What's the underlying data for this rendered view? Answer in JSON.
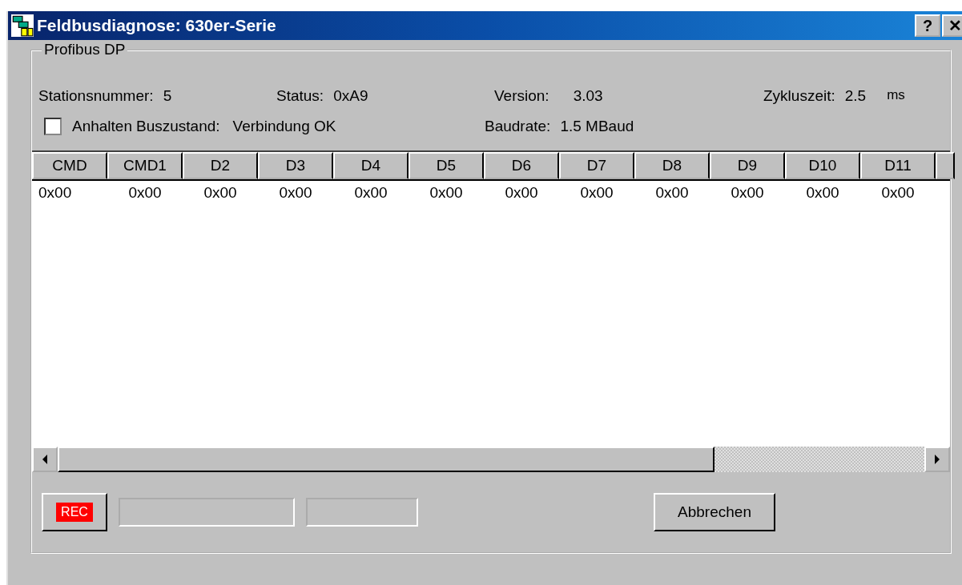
{
  "window": {
    "title": "Feldbusdiagnose: 630er-Serie",
    "help_button": "?",
    "close_button": "✕"
  },
  "group": {
    "title": "Profibus DP",
    "info_row_1": [
      {
        "label": "Stationsnummer:",
        "value": "5"
      },
      {
        "label": "Status:",
        "value": "0xA9"
      },
      {
        "label": "Version:",
        "value": "3.03"
      },
      {
        "label": "Zykluszeit:",
        "value": "2.5",
        "unit": "ms"
      }
    ],
    "pause_checkbox": {
      "label": "Anhalten",
      "checked": false
    },
    "info_row_2": [
      {
        "label": "Buszustand:",
        "value": "Verbindung OK"
      },
      {
        "label": "Baudrate:",
        "value": "1.5 MBaud"
      }
    ],
    "table": {
      "columns": [
        "CMD",
        "CMD1",
        "D2",
        "D3",
        "D4",
        "D5",
        "D6",
        "D7",
        "D8",
        "D9",
        "D10",
        "D11"
      ],
      "rows": [
        [
          "0x00",
          "0x00",
          "0x00",
          "0x00",
          "0x00",
          "0x00",
          "0x00",
          "0x00",
          "0x00",
          "0x00",
          "0x00",
          "0x00"
        ]
      ]
    }
  },
  "footer": {
    "record_button": "REC",
    "cancel_button": "Abbrechen"
  }
}
